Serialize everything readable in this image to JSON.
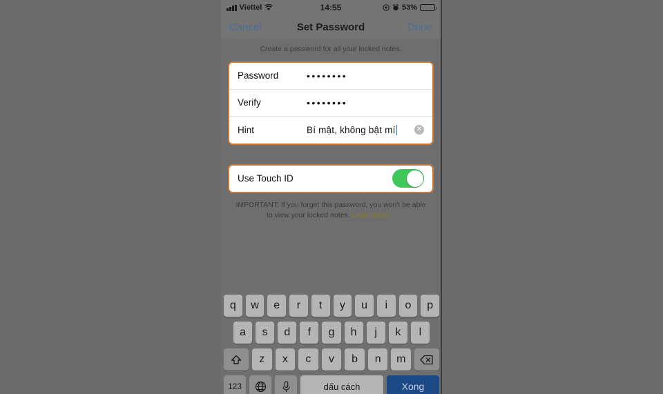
{
  "statusbar": {
    "carrier": "Viettel",
    "time": "14:55",
    "battery_percent": "53%",
    "icons": [
      "signal-bars-icon",
      "wifi-icon",
      "location-icon",
      "alarm-clock-icon",
      "battery-icon"
    ]
  },
  "navbar": {
    "cancel_label": "Cancel",
    "title": "Set Password",
    "done_label": "Done"
  },
  "content": {
    "subtitle": "Create a password for all your locked notes.",
    "fields": [
      {
        "label": "Password",
        "value": "••••••••",
        "type": "secure"
      },
      {
        "label": "Verify",
        "value": "••••••••",
        "type": "secure"
      },
      {
        "label": "Hint",
        "value": "Bí mật, không bật mí",
        "type": "text"
      }
    ],
    "touch_id": {
      "label": "Use Touch ID",
      "enabled": true,
      "on_color": "#3ec75a"
    },
    "important_prefix": "IMPORTANT: If you forget this password, you won't be able to view your locked notes. ",
    "learn_more_label": "Learn more..."
  },
  "keyboard": {
    "row1": [
      "q",
      "w",
      "e",
      "r",
      "t",
      "y",
      "u",
      "i",
      "o",
      "p"
    ],
    "row2": [
      "a",
      "s",
      "d",
      "f",
      "g",
      "h",
      "j",
      "k",
      "l"
    ],
    "row3": [
      "z",
      "x",
      "c",
      "v",
      "b",
      "n",
      "m"
    ],
    "shift_icon": "shift-arrow-icon",
    "backspace_icon": "backspace-icon",
    "numeric_label": "123",
    "globe_icon": "globe-icon",
    "mic_icon": "microphone-icon",
    "space_label": "dấu cách",
    "done_label": "Xong"
  },
  "colors": {
    "backdrop": "#6b6b6b",
    "highlight_border": "#d2772e",
    "link_blue": "#4a6f96",
    "keyboard_done_blue": "#1c4a86",
    "learn_more": "#8d7b28"
  }
}
